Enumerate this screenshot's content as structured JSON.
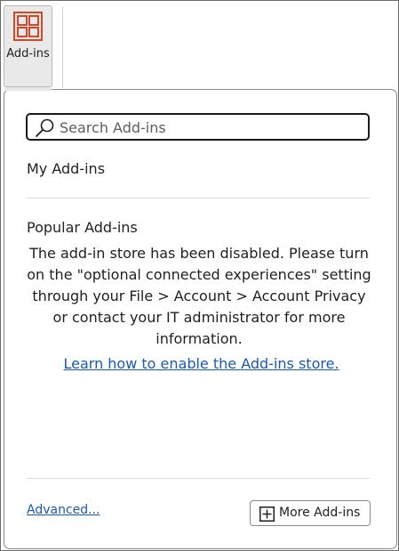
{
  "ribbon": {
    "addins_button_label": "Add-ins",
    "addins_icon": "addins-grid-icon",
    "accent_color": "#d24726"
  },
  "panel": {
    "search": {
      "placeholder": "Search Add-ins",
      "value": "",
      "icon": "search-icon"
    },
    "my_addins_title": "My Add-ins",
    "popular_addins_title": "Popular Add-ins",
    "disabled_message": "The add-in store has been disabled. Please turn on the \"optional connected experiences\" setting through your File > Account > Account Privacy or contact your IT administrator for more information.",
    "learn_link": "Learn how to enable the Add-ins store.",
    "advanced_link": "Advanced...",
    "more_addins_button": "More Add-ins",
    "more_addins_icon": "plus-box-icon",
    "link_color": "#1859b8"
  }
}
